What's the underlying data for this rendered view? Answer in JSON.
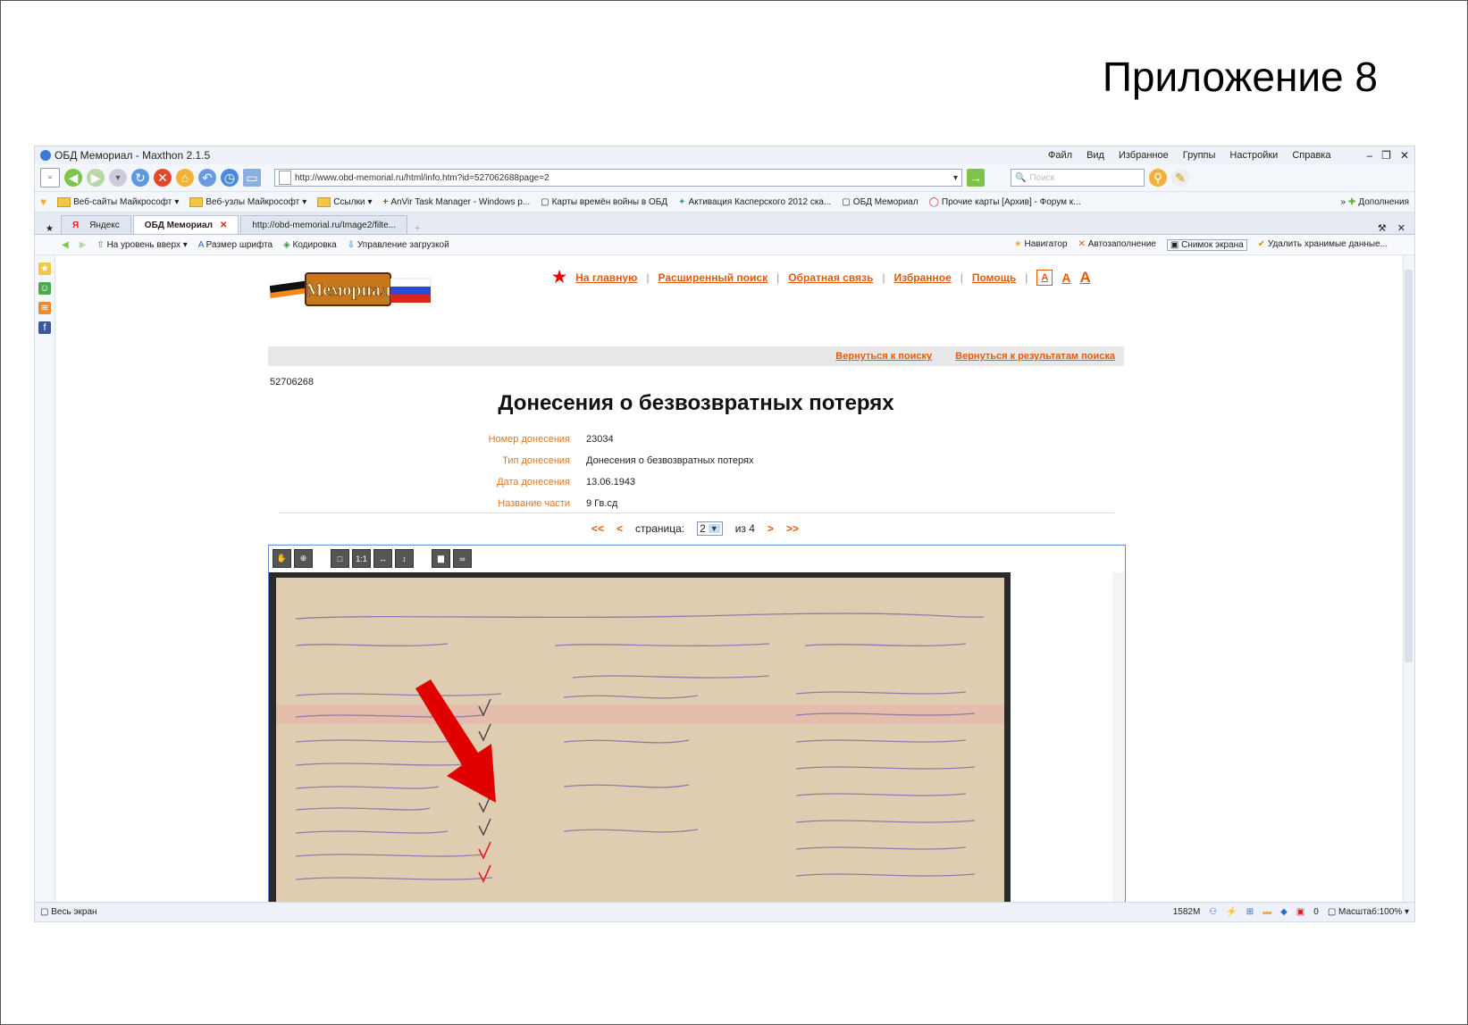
{
  "slide": {
    "title": "Приложение 8"
  },
  "browser": {
    "title": "ОБД Мемориал - Maxthon 2.1.5",
    "menu": [
      "Файл",
      "Вид",
      "Избранное",
      "Группы",
      "Настройки",
      "Справка"
    ],
    "address": "http://www.obd-memorial.ru/html/info.htm?id=527062688page=2",
    "search_placeholder": "Поиск",
    "bookmarks": [
      "Веб-сайты Майкрософт",
      "Веб-узлы Майкрософт",
      "Ссылки",
      "AnVir Task Manager - Windows p...",
      "Карты времён войны в ОБД",
      "Активация Касперского 2012 ска...",
      "ОБД Мемориал",
      "Прочие карты [Архив] - Форум к..."
    ],
    "addons": "Дополнения",
    "tabs": [
      {
        "label": "Яндекс"
      },
      {
        "label": "ОБД Мемориал"
      },
      {
        "label": "http://obd-memorial.ru/Image2/filte..."
      }
    ],
    "linkbar_left": [
      "На уровень вверх",
      "Размер шрифта",
      "Кодировка",
      "Управление загрузкой"
    ],
    "linkbar_right": [
      "Навигатор",
      "Автозаполнение",
      "Снимок экрана",
      "Удалить хранимые данные..."
    ],
    "status": {
      "left": "Весь экран",
      "memory": "1582M",
      "count": "0",
      "zoom": "Масштаб:100%"
    }
  },
  "site": {
    "nav": [
      "На главную",
      "Расширенный поиск",
      "Обратная связь",
      "Избранное",
      "Помощь"
    ],
    "font_sizes": [
      "A",
      "A",
      "A"
    ],
    "back_links": [
      "Вернуться к поиску",
      "Вернуться к результатам поиска"
    ],
    "record_id": "52706268",
    "heading": "Донесения о безвозвратных потерях",
    "fields": [
      {
        "label": "Номер донесения",
        "value": "23034"
      },
      {
        "label": "Тип донесения",
        "value": "Донесения о безвозвратных потерях"
      },
      {
        "label": "Дата донесения",
        "value": "13.06.1943"
      },
      {
        "label": "Название части",
        "value": "9 Гв.сд"
      }
    ],
    "pager": {
      "first": "<<",
      "prev": "<",
      "label": "страница:",
      "current": "2",
      "of": "из 4",
      "next": ">",
      "last": ">>"
    },
    "viewer_tools": [
      "hand-tool",
      "zoom-in",
      "fit-page",
      "actual-size",
      "fit-width",
      "fit-height",
      "save",
      "link"
    ]
  },
  "colors": {
    "accent": "#e25a0a",
    "arrow": "#e00000",
    "field_label": "#e2751e"
  }
}
